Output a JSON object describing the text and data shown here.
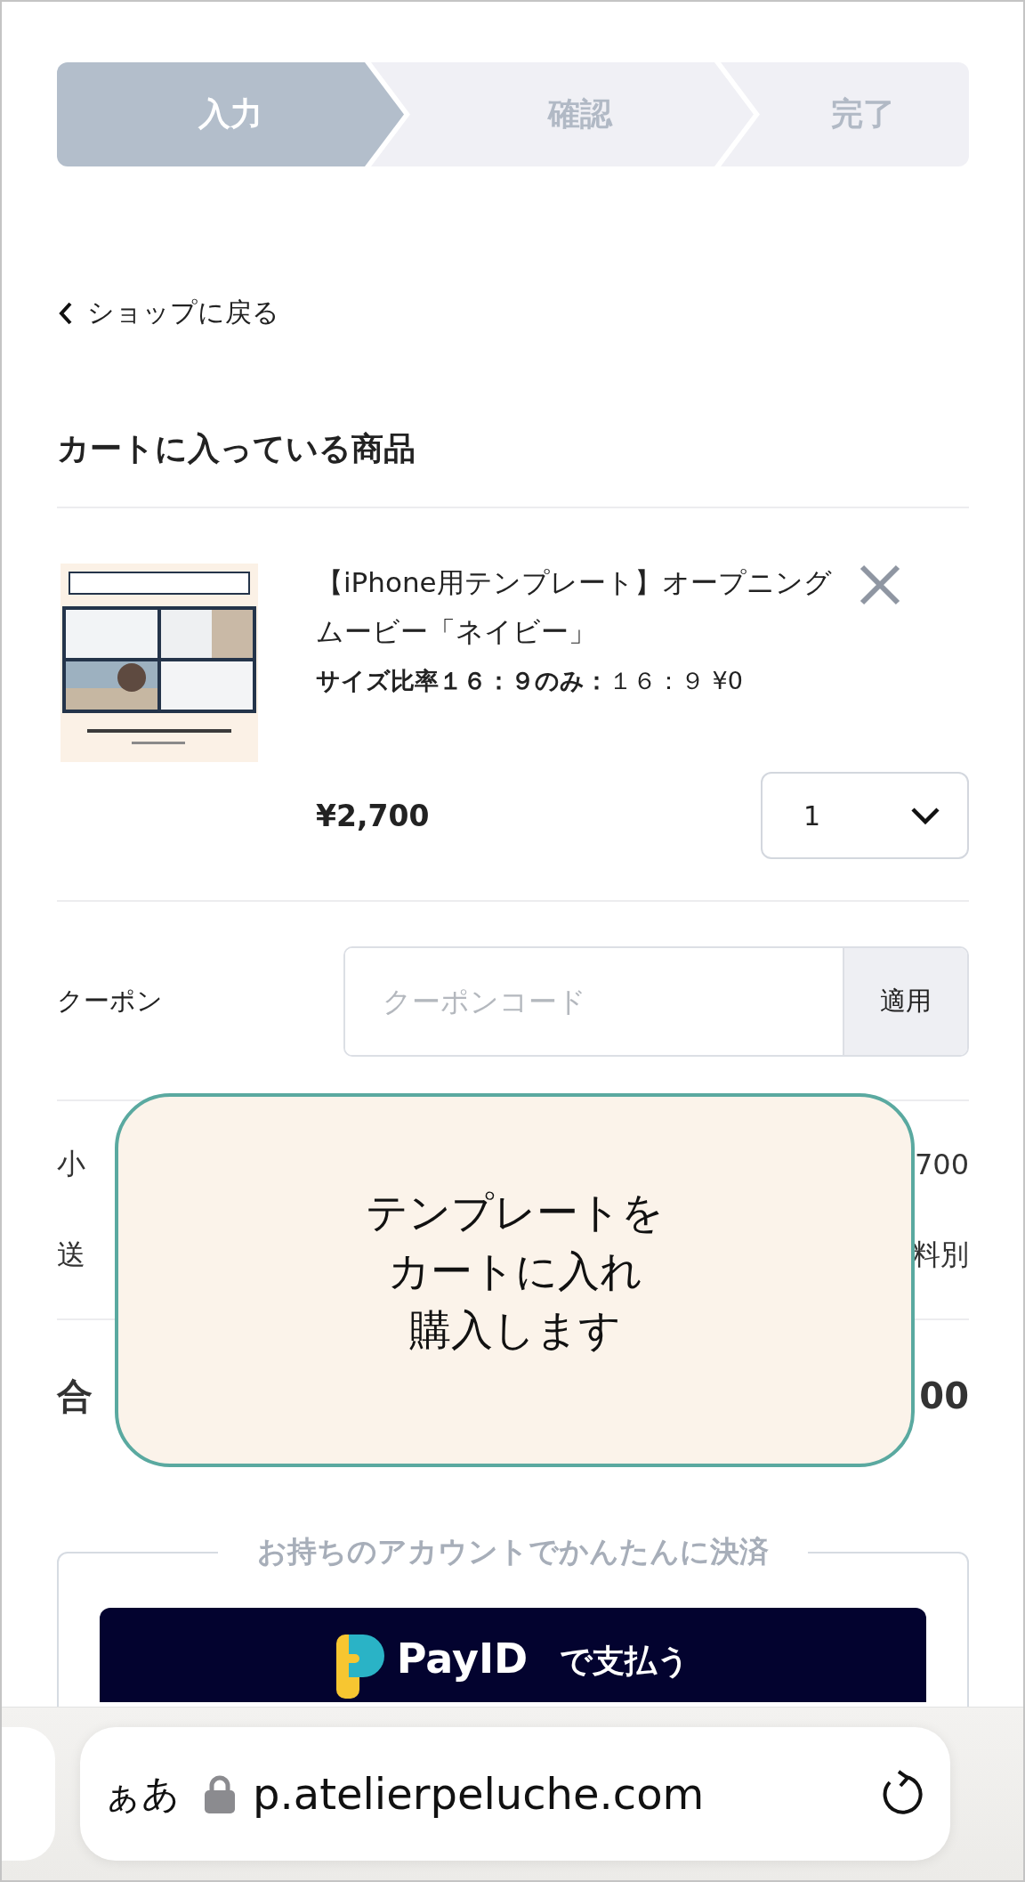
{
  "stepper": [
    {
      "label": "入力",
      "selected": true
    },
    {
      "label": "確認",
      "selected": false
    },
    {
      "label": "完了",
      "selected": false
    }
  ],
  "back_link": "ショップに戻る",
  "cart": {
    "heading": "カートに入っている商品",
    "item": {
      "title": "【iPhone用テンプレート】オープニングムービー「ネイビー」",
      "option_label": "サイズ比率１６：９のみ：",
      "option_value": "１６：９ ¥0",
      "price": "¥2,700",
      "quantity": "1"
    }
  },
  "coupon": {
    "label": "クーポン",
    "placeholder": "クーポンコード",
    "button": "適用"
  },
  "totals": [
    {
      "kind": "line",
      "label": "小",
      "value": "700"
    },
    {
      "kind": "line",
      "label": "送",
      "value": "料別"
    },
    {
      "kind": "total",
      "label": "合",
      "value": "00"
    }
  ],
  "overlay": {
    "lines": [
      "テンプレートを",
      "カートに入れ",
      "購入します"
    ]
  },
  "payment": {
    "legend": "お持ちのアカウントでかんたんに決済",
    "brand": "PayID",
    "label": "で支払う"
  },
  "browser_bar": {
    "text_size_button": "ぁあ",
    "url": "p.atelierpeluche.com"
  }
}
